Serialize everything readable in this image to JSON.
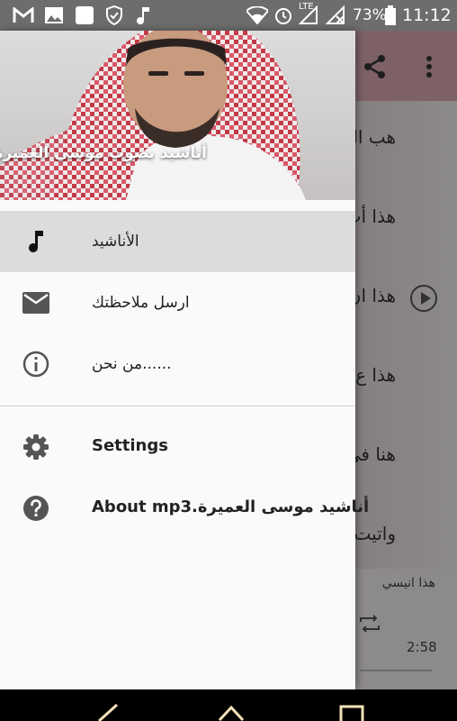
{
  "status_bar": {
    "battery_percent": "73%",
    "time": "11:12",
    "network_label": "LTE",
    "icons": [
      "gmail-icon",
      "image-icon",
      "blank-notification-icon",
      "shield-icon",
      "music-note-icon",
      "wifi-icon",
      "alarm-icon",
      "signal-icon",
      "no-signal-icon",
      "battery-icon"
    ]
  },
  "app": {
    "toolbar_icons": [
      "share-icon",
      "more-vert-icon"
    ],
    "list_rows": [
      {
        "title": "هب ال"
      },
      {
        "title": "هذا أب"
      },
      {
        "title": "هذا ان"
      },
      {
        "title": "هذا ع"
      },
      {
        "title": "هنا في"
      },
      {
        "title": "واتيت"
      }
    ],
    "player": {
      "title": "هذا انيسي",
      "time": "2:58"
    }
  },
  "drawer": {
    "header_title": "أناشيد بصوت موسى العميرة",
    "menu_primary": [
      {
        "label": "الأناشيد",
        "icon": "music-note-icon",
        "active": true
      },
      {
        "label": "ارسل ملاحظتك",
        "icon": "mail-icon",
        "active": false
      },
      {
        "label": "من نحن......",
        "icon": "info-icon",
        "active": false
      }
    ],
    "menu_secondary": [
      {
        "label": "Settings",
        "icon": "gear-icon"
      },
      {
        "label": "About mp3.أناشيد موسى العميرة",
        "icon": "help-icon"
      }
    ]
  },
  "navbar": {
    "icons": [
      "back-icon",
      "home-icon",
      "recents-icon"
    ]
  },
  "colors": {
    "drawer_bg": "#fafafa",
    "active_item_bg": "#dcdcdc",
    "toolbar_accent": "#d7a7b2",
    "icon_color": "#555555"
  }
}
